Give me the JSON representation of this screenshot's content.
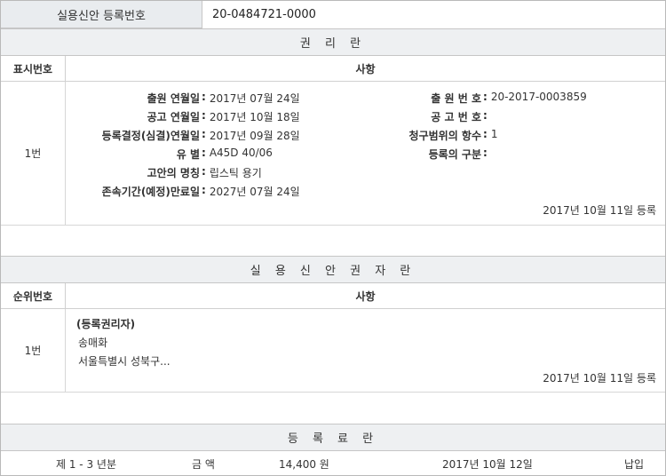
{
  "header": {
    "label": "실용신안 등록번호",
    "value": "20-0484721-0000"
  },
  "rights_section": {
    "title": "권 리 란",
    "col_num": "표시번호",
    "col_detail": "사항",
    "row_num": "1번",
    "left": [
      {
        "label": "출원 연월일",
        "value": "2017년 07월 24일"
      },
      {
        "label": "공고 연월일",
        "value": "2017년 10월 18일"
      },
      {
        "label": "등록결정(심결)연월일",
        "value": "2017년 09월 28일"
      },
      {
        "label": "유 별",
        "value": "A45D 40/06"
      },
      {
        "label": "고안의 명칭",
        "value": "립스틱 용기"
      },
      {
        "label": "존속기간(예정)만료일",
        "value": "2027년 07월 24일"
      }
    ],
    "right": [
      {
        "label": "출 원 번 호",
        "value": "20-2017-0003859"
      },
      {
        "label": "공 고 번 호",
        "value": ""
      },
      {
        "label": "청구범위의 항수",
        "value": "1"
      },
      {
        "label": "등록의 구분",
        "value": ""
      }
    ],
    "stamp": "2017년 10월 11일 등록"
  },
  "holder_section": {
    "title": "실 용 신 안 권 자 란",
    "col_num": "순위번호",
    "col_detail": "사항",
    "row_num": "1번",
    "holder_label": "(등록권리자)",
    "name": "송매화",
    "address": "서울특별시 성북구...",
    "stamp": "2017년 10월 11일 등록"
  },
  "fee_section": {
    "title": "등 록 료 란",
    "period": "제 1 - 3 년분",
    "amount_label": "금 액",
    "amount": "14,400 원",
    "date": "2017년 10월 12일",
    "status": "납입"
  }
}
